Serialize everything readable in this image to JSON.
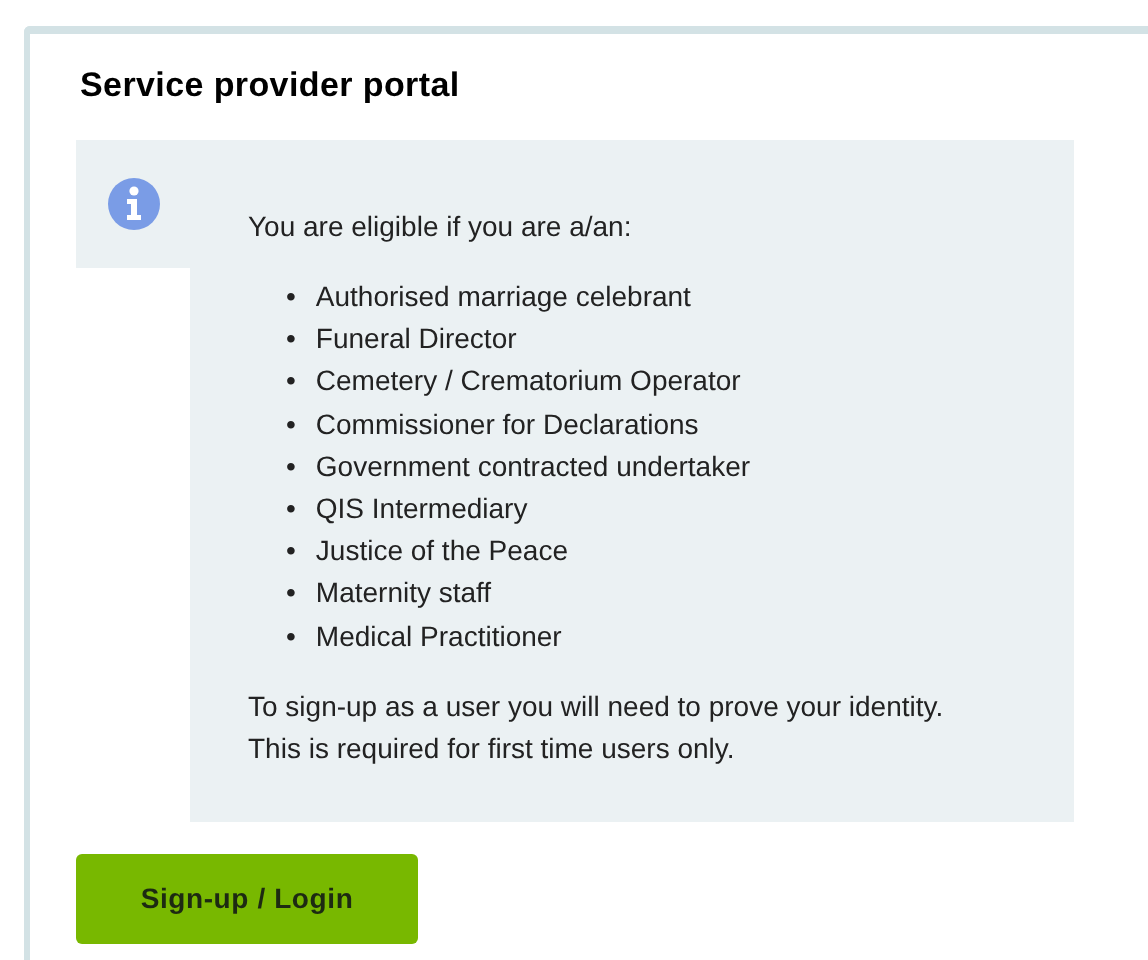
{
  "title": "Service provider portal",
  "notice": {
    "intro": "You are eligible if you are a/an:",
    "bullet": "•",
    "items": [
      "Authorised marriage celebrant",
      "Funeral Director",
      "Cemetery / Crematorium Operator",
      "Commissioner for Declarations",
      "Government contracted undertaker",
      "QIS Intermediary",
      "Justice of the Peace",
      "Maternity staff",
      "Medical Practitioner"
    ],
    "note_lines": [
      "To sign-up as a user you will need to prove your identity.",
      "This is required for first time users only."
    ]
  },
  "button": "Sign-up / Login"
}
